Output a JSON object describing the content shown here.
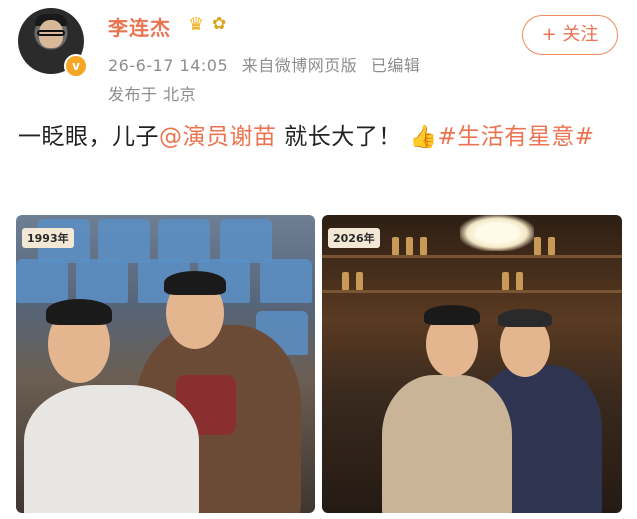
{
  "user": {
    "name": "李连杰",
    "verified_badge": "v",
    "crown_icon": "♛",
    "flower_icon": "✿"
  },
  "meta": {
    "time": "26-6-17 14:05",
    "source": "来自微博网页版",
    "edited": "已编辑",
    "location": "发布于 北京"
  },
  "follow_button": {
    "label": "+ 关注"
  },
  "post": {
    "text_before": "一眨眼，儿子",
    "mention": "@演员谢苗",
    "text_after": " 就长大了！",
    "emoji": "👍",
    "hashtag": "#生活有星意#"
  },
  "photos": [
    {
      "year_label": "1993年"
    },
    {
      "year_label": "2026年"
    }
  ],
  "colors": {
    "accent": "#eb7350",
    "meta_gray": "#8d8d8d"
  }
}
